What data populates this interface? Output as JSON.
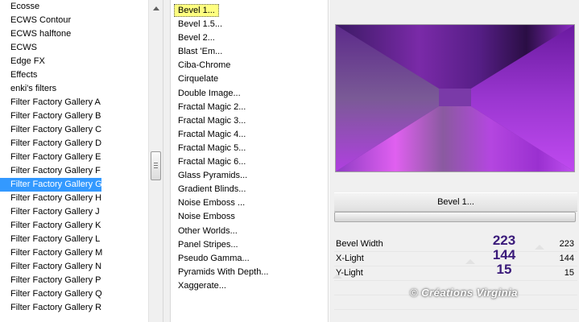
{
  "categories": [
    {
      "label": "Ecosse"
    },
    {
      "label": "ECWS Contour"
    },
    {
      "label": "ECWS halftone"
    },
    {
      "label": "ECWS"
    },
    {
      "label": "Edge FX"
    },
    {
      "label": "Effects"
    },
    {
      "label": "enki's filters"
    },
    {
      "label": "Filter Factory Gallery A"
    },
    {
      "label": "Filter Factory Gallery B"
    },
    {
      "label": "Filter Factory Gallery C"
    },
    {
      "label": "Filter Factory Gallery D"
    },
    {
      "label": "Filter Factory Gallery E"
    },
    {
      "label": "Filter Factory Gallery F"
    },
    {
      "label": "Filter Factory Gallery G"
    },
    {
      "label": "Filter Factory Gallery H"
    },
    {
      "label": "Filter Factory Gallery J"
    },
    {
      "label": "Filter Factory Gallery K"
    },
    {
      "label": "Filter Factory Gallery L"
    },
    {
      "label": "Filter Factory Gallery M"
    },
    {
      "label": "Filter Factory Gallery N"
    },
    {
      "label": "Filter Factory Gallery P"
    },
    {
      "label": "Filter Factory Gallery Q"
    },
    {
      "label": "Filter Factory Gallery R"
    }
  ],
  "selected_category": "Filter Factory Gallery G",
  "filters": [
    {
      "label": "Bevel 1..."
    },
    {
      "label": "Bevel 1.5..."
    },
    {
      "label": "Bevel 2..."
    },
    {
      "label": "Blast 'Em..."
    },
    {
      "label": "Ciba-Chrome"
    },
    {
      "label": "Cirquelate"
    },
    {
      "label": "Double Image..."
    },
    {
      "label": "Fractal Magic 2..."
    },
    {
      "label": "Fractal Magic 3..."
    },
    {
      "label": "Fractal Magic 4..."
    },
    {
      "label": "Fractal Magic 5..."
    },
    {
      "label": "Fractal Magic 6..."
    },
    {
      "label": "Glass Pyramids..."
    },
    {
      "label": "Gradient Blinds..."
    },
    {
      "label": "Noise Emboss ..."
    },
    {
      "label": "Noise Emboss"
    },
    {
      "label": "Other Worlds..."
    },
    {
      "label": "Panel Stripes..."
    },
    {
      "label": "Pseudo Gamma..."
    },
    {
      "label": "Pyramids With Depth..."
    },
    {
      "label": "Xaggerate..."
    }
  ],
  "selected_filter": "Bevel 1...",
  "filter_title": "Bevel 1...",
  "params": [
    {
      "label": "Bevel Width",
      "big": "223",
      "value": "223"
    },
    {
      "label": "X-Light",
      "big": "144",
      "value": "144"
    },
    {
      "label": "Y-Light",
      "big": "15",
      "value": "15"
    }
  ],
  "watermark": "© Créations Virginia",
  "icons": {
    "scroll_up": "arrow-up-icon",
    "scroll_thumb": "scroll-thumb-grip-icon"
  },
  "colors": {
    "selection": "#3399ff",
    "highlight": "#ffff80",
    "param_value": "#3a1a7a"
  }
}
